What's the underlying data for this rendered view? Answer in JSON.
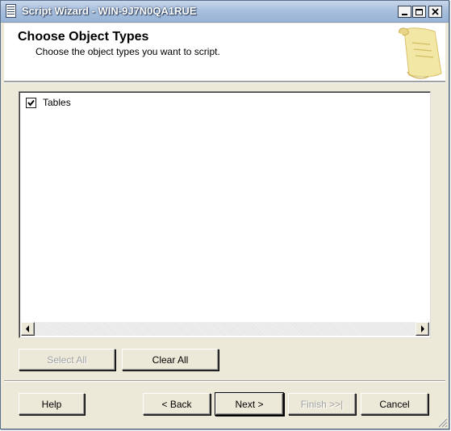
{
  "window": {
    "title": "Script Wizard - WIN-9J7N0QA1RUE"
  },
  "header": {
    "title": "Choose Object Types",
    "subtitle": "Choose the object types you want to script."
  },
  "object_list": {
    "items": [
      {
        "label": "Tables",
        "checked": true
      }
    ]
  },
  "list_buttons": {
    "select_all": "Select All",
    "clear_all": "Clear All"
  },
  "nav_buttons": {
    "help": "Help",
    "back": "< Back",
    "next": "Next >",
    "finish": "Finish >>|",
    "cancel": "Cancel"
  },
  "colors": {
    "titlebar": "#a9c0de",
    "dialog_background": "#ece9d8",
    "header_background": "#ffffff",
    "disabled_text": "#a0a0a0"
  },
  "icons": {
    "title_icon": "script-document-icon",
    "header_graphic": "parchment-scroll-icon",
    "checkbox": "checkmark-icon",
    "scroll_left": "arrow-left-icon",
    "scroll_right": "arrow-right-icon",
    "resize": "size-grip-icon"
  }
}
